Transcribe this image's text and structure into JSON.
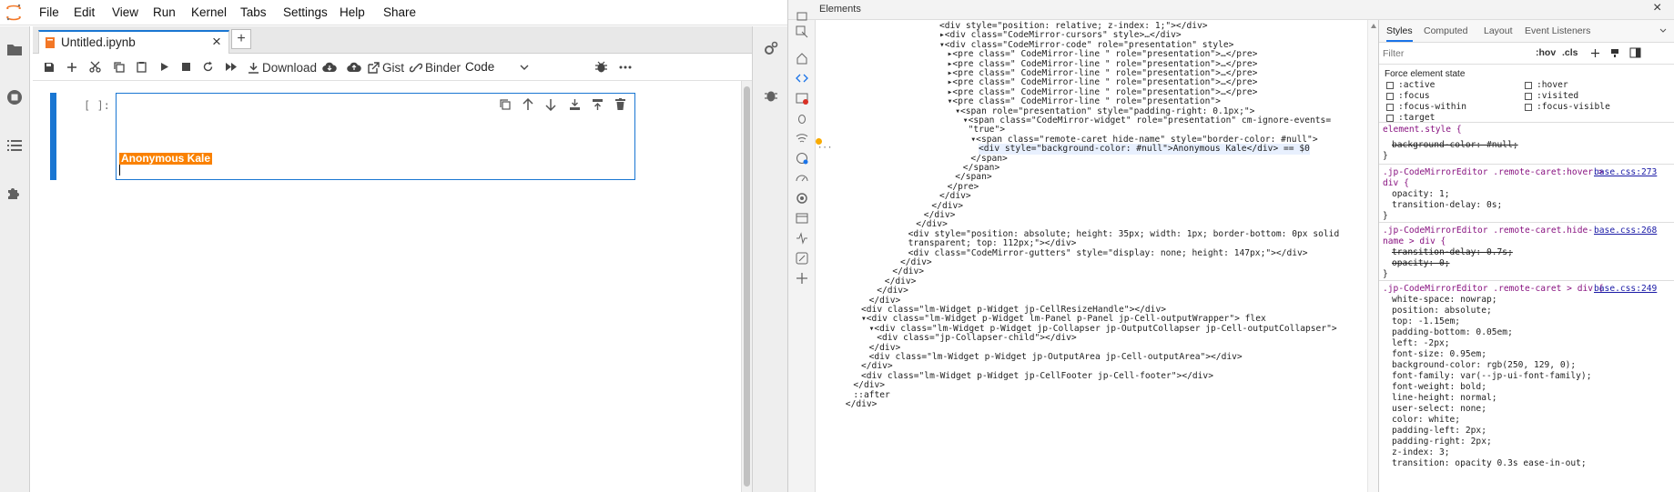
{
  "menubar": {
    "items": [
      "File",
      "Edit",
      "View",
      "Run",
      "Kernel",
      "Tabs",
      "Settings",
      "Help",
      "Share"
    ]
  },
  "tab": {
    "title": "Untitled.ipynb",
    "close": "×",
    "add": "+"
  },
  "toolbar": {
    "download": "Download",
    "gist": "Gist",
    "binder": "Binder",
    "cell_type": "Code"
  },
  "cell": {
    "prompt": "[ ]:",
    "remote_name": "Anonymous Kale",
    "remote_color": "#fa8100"
  },
  "devtools": {
    "title": "Elements",
    "close": "×",
    "dom_lines": [
      {
        "indent": 0,
        "html": "<div style=\"position: relative; z-index: 1;\"></div>"
      },
      {
        "indent": 0,
        "html": "▸<div class=\"CodeMirror-cursors\" style>…</div>"
      },
      {
        "indent": 0,
        "html": "▾<div class=\"CodeMirror-code\" role=\"presentation\" style>"
      },
      {
        "indent": 1,
        "html": "▸<pre class=\" CodeMirror-line \" role=\"presentation\">…</pre>"
      },
      {
        "indent": 1,
        "html": "▸<pre class=\" CodeMirror-line \" role=\"presentation\">…</pre>"
      },
      {
        "indent": 1,
        "html": "▸<pre class=\" CodeMirror-line \" role=\"presentation\">…</pre>"
      },
      {
        "indent": 1,
        "html": "▸<pre class=\" CodeMirror-line \" role=\"presentation\">…</pre>"
      },
      {
        "indent": 1,
        "html": "▸<pre class=\" CodeMirror-line \" role=\"presentation\">…</pre>"
      },
      {
        "indent": 1,
        "html": "▾<pre class=\" CodeMirror-line \" role=\"presentation\">"
      },
      {
        "indent": 2,
        "html": "▾<span role=\"presentation\" style=\"padding-right: 0.1px;\">"
      },
      {
        "indent": 3,
        "html": "▾<span class=\"CodeMirror-widget\" role=\"presentation\" cm-ignore-events="
      },
      {
        "indent": 3,
        "html": " \"true\">"
      },
      {
        "indent": 4,
        "html": "▾<span class=\"remote-caret hide-name\" style=\"border-color: #null\">"
      },
      {
        "indent": 5,
        "html": "<div style=\"background-color: #null\">Anonymous Kale</div> == $0"
      },
      {
        "indent": 4,
        "html": "</span>"
      },
      {
        "indent": 3,
        "html": "</span>"
      },
      {
        "indent": 2,
        "html": "</span>"
      },
      {
        "indent": 1,
        "html": "</pre>"
      },
      {
        "indent": 0,
        "html": "</div>"
      },
      {
        "indent": -1,
        "html": "</div>"
      },
      {
        "indent": -2,
        "html": "</div>"
      },
      {
        "indent": -3,
        "html": "</div>"
      },
      {
        "indent": -4,
        "html": "<div style=\"position: absolute; height: 35px; width: 1px; border-bottom: 0px solid"
      },
      {
        "indent": -4,
        "html": "transparent; top: 112px;\"></div>"
      },
      {
        "indent": -4,
        "html": "<div class=\"CodeMirror-gutters\" style=\"display: none; height: 147px;\"></div>"
      },
      {
        "indent": -5,
        "html": "</div>"
      },
      {
        "indent": -6,
        "html": "</div>"
      },
      {
        "indent": -7,
        "html": "</div>"
      },
      {
        "indent": -8,
        "html": "</div>"
      },
      {
        "indent": -9,
        "html": "</div>"
      },
      {
        "indent": -10,
        "html": "<div class=\"lm-Widget p-Widget jp-CellResizeHandle\"></div>"
      },
      {
        "indent": -10,
        "html": "▾<div class=\"lm-Widget p-Widget lm-Panel p-Panel jp-Cell-outputWrapper\"> flex"
      },
      {
        "indent": -9,
        "html": "▾<div class=\"lm-Widget p-Widget jp-Collapser jp-OutputCollapser jp-Cell-outputCollapser\">"
      },
      {
        "indent": -8,
        "html": "<div class=\"jp-Collapser-child\"></div>"
      },
      {
        "indent": -9,
        "html": "</div>"
      },
      {
        "indent": -9,
        "html": "<div class=\"lm-Widget p-Widget jp-OutputArea jp-Cell-outputArea\"></div>"
      },
      {
        "indent": -10,
        "html": "</div>"
      },
      {
        "indent": -10,
        "html": "<div class=\"lm-Widget p-Widget jp-CellFooter jp-Cell-footer\"></div>"
      },
      {
        "indent": -11,
        "html": "</div>"
      },
      {
        "indent": -11,
        "html": "::after"
      },
      {
        "indent": -12,
        "html": "</div>"
      }
    ],
    "styles": {
      "tabs": [
        "Styles",
        "Computed",
        "Layout",
        "Event Listeners"
      ],
      "filter_placeholder": "Filter",
      "hov": ":hov",
      "cls": ".cls",
      "force_state": "Force element state",
      "states_left": [
        ":active",
        ":focus",
        ":focus-within",
        ":target"
      ],
      "states_right": [
        ":hover",
        ":visited",
        ":focus-visible"
      ],
      "element_style": "element.style {",
      "bg_null": "background-color: #null;",
      "rule1_sel": ".jp-CodeMirrorEditor .remote-caret:hover >",
      "rule1_sel2": "div {",
      "rule1_link": "base.css:273",
      "rule1_props": [
        "opacity: 1;",
        "transition-delay: 0s;"
      ],
      "rule2_sel": ".jp-CodeMirrorEditor .remote-caret.hide-",
      "rule2_sel2": "name > div {",
      "rule2_link": "base.css:268",
      "rule2_props": [
        "transition-delay: 0.7s;",
        "opacity: 0;"
      ],
      "rule3_sel": ".jp-CodeMirrorEditor .remote-caret > div {",
      "rule3_link": "base.css:249",
      "rule3_props": [
        "white-space: nowrap;",
        "position: absolute;",
        "top: -1.15em;",
        "padding-bottom: 0.05em;",
        "left: -2px;",
        "font-size: 0.95em;",
        "background-color: rgb(250, 129, 0);",
        "font-family: var(--jp-ui-font-family);",
        "font-weight: bold;",
        "line-height: normal;",
        "user-select: none;",
        "color: white;",
        "padding-left: 2px;",
        "padding-right: 2px;",
        "z-index: 3;",
        "transition: opacity 0.3s ease-in-out;"
      ],
      "close_brace": "}"
    }
  }
}
